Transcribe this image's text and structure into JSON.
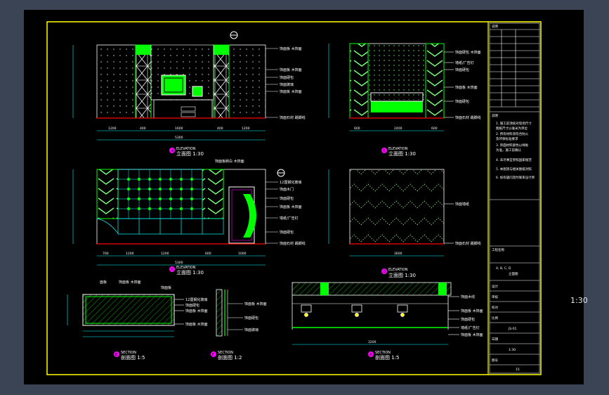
{
  "viewport": {
    "scale_text": "1:30"
  },
  "colors": {
    "background": "#3a4454",
    "sheet": "#000000",
    "frame": "#ffff00",
    "linework": "#ffffff",
    "accent": "#00ff00",
    "highlight": "#ff00ff",
    "dims": "#00ffff",
    "floor": "#ff0000"
  },
  "drawings": [
    {
      "id": "A",
      "caption_en": "ELEVATION",
      "caption_cn": "立面图 1:30"
    },
    {
      "id": "B",
      "caption_en": "ELEVATION",
      "caption_cn": "立面图 1:30"
    },
    {
      "id": "C",
      "caption_en": "ELEVATION",
      "caption_cn": "立面图 1:30"
    },
    {
      "id": "D",
      "caption_en": "ELEVATION",
      "caption_cn": "立面图 1:30"
    },
    {
      "id": "E",
      "caption_en": "SECTION",
      "caption_cn": "剖面图 1:5"
    },
    {
      "id": "F",
      "caption_en": "SECTION",
      "caption_cn": "剖面图 1:2"
    },
    {
      "id": "G",
      "caption_en": "SECTION",
      "caption_cn": "剖面图 1:5"
    }
  ],
  "title_block": {
    "top_label": "说明",
    "notes_label": "说明",
    "project_label": "工程名称",
    "drawing_name": "立面图",
    "drawing_code": "A, B, C, D",
    "scale_label": "比例",
    "scale_value": "1:30",
    "sheet_label": "图号",
    "sheet_value": "15",
    "drawing_no": "JS-01"
  }
}
